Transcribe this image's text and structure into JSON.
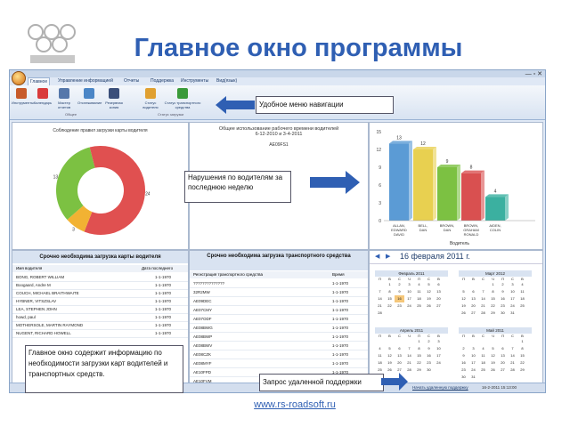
{
  "slide": {
    "title": "Главное окно программы",
    "website": "www.rs-roadsoft.ru"
  },
  "app": {
    "tabs": [
      "Главное",
      "Управление информацией",
      "Отчеты",
      "Поддержка",
      "Инструменты",
      "Вид(язык)"
    ],
    "ribbon_buttons": [
      "Инструменты",
      "Календарь",
      "Мастер отчетов",
      "Отслеживание",
      "Резервная копия",
      "Статус водителя",
      "Статус транспортного средства"
    ],
    "ribbon_groups": [
      "Общее",
      "Статус загрузки"
    ],
    "chart1_title": "Соблюдение правил загрузки карты водителя",
    "chart2_title": "Общее использование рабочего времени водителей",
    "chart2_dates": "6-12-2010 и 3-4-2011",
    "chart2_sub": "AE09FS1",
    "drivers_panel_title": "Срочно необходима загрузка карты водителя",
    "drivers_columns": [
      "Имя водителя",
      "Дата последнего"
    ],
    "drivers": [
      {
        "name": "BONG, ROBERT WILLIAM",
        "date": "1-1-1970"
      },
      {
        "name": "Boogaard, Andre M",
        "date": "1-1-1970"
      },
      {
        "name": "COUCH, MICHAEL BRAITHWAITE",
        "date": "1-1-1970"
      },
      {
        "name": "HYBNER, VITSZSLAV",
        "date": "1-1-1970"
      },
      {
        "name": "LEA, STEPHEN JOHN",
        "date": "1-1-1970"
      },
      {
        "name": "howd, paul",
        "date": "1-1-1970"
      },
      {
        "name": "MOTHERSOLE, MARTIN RAYMOND",
        "date": "1-1-1970"
      },
      {
        "name": "NUGENT, RICHARD HOWELL",
        "date": "1-1-1970"
      }
    ],
    "vehicles_panel_title": "Срочно необходима загрузка транспортного средства",
    "vehicles_columns": [
      "Регистрация транспортного средства",
      "Время"
    ],
    "vehicles": [
      {
        "reg": "??????????????",
        "date": "1-1-1970"
      },
      {
        "reg": "32R2MW",
        "date": "1-1-1970"
      },
      {
        "reg": "AE09DEC",
        "date": "1-1-1970"
      },
      {
        "reg": "AE07CMY",
        "date": "1-1-1970"
      },
      {
        "reg": "AE07ODF",
        "date": "1-1-1970"
      },
      {
        "reg": "AE08BWG",
        "date": "1-1-1970"
      },
      {
        "reg": "AE08BWP",
        "date": "1-1-1970"
      },
      {
        "reg": "AE08BWV",
        "date": "1-1-1970"
      },
      {
        "reg": "AE08CZK",
        "date": "1-1-1970"
      },
      {
        "reg": "AE08MYF",
        "date": "1-1-1970"
      },
      {
        "reg": "AE10FPD",
        "date": "1-1-1970"
      },
      {
        "reg": "AE10FVM",
        "date": "1-1-1970"
      }
    ],
    "calendar_date": "16 февраля 2011 г.",
    "calendar_months": [
      "Февраль 2011",
      "Март 2012",
      "Апрель 2011",
      "Май 2011"
    ],
    "weekdays": [
      "П",
      "В",
      "С",
      "Ч",
      "П",
      "С",
      "В"
    ],
    "support_link": "Начать удаленную поддержку",
    "status_time": "16-2-2011 15:13:00"
  },
  "callouts": {
    "nav": "Удобное меню навигации",
    "violations": "Нарушения по водителям за последнюю неделю",
    "main_info": "Главное окно содержит информацию по необходимости загрузки карт водителей и транспортных средств.",
    "remote": "Запрос удаленной поддержки"
  },
  "chart_data": [
    {
      "type": "pie",
      "title": "Соблюдение правил загрузки карты водителя",
      "labels": [
        "24",
        "3",
        "13"
      ],
      "values": [
        24,
        3,
        13
      ],
      "colors": [
        "#e05050",
        "#f2b233",
        "#7cc142"
      ]
    },
    {
      "type": "bar",
      "categories": [
        "ALLAN, EDWARD DAVID",
        "BELL, DAN",
        "BROWN, DAN",
        "BROWN, GRAHAM RONALD",
        "AIDEN, COLIN"
      ],
      "values": [
        13,
        12,
        9,
        8,
        4
      ],
      "ylim": [
        0,
        15
      ],
      "yticks": [
        "0",
        "3",
        "6",
        "9",
        "12",
        "15"
      ],
      "xlabel": "Водитель",
      "bar_labels": [
        "13",
        "12",
        "9",
        "8",
        "4"
      ],
      "colors": [
        "#5b9bd5",
        "#e8d050",
        "#7cc142",
        "#d95050",
        "#3bb0a0"
      ]
    }
  ]
}
